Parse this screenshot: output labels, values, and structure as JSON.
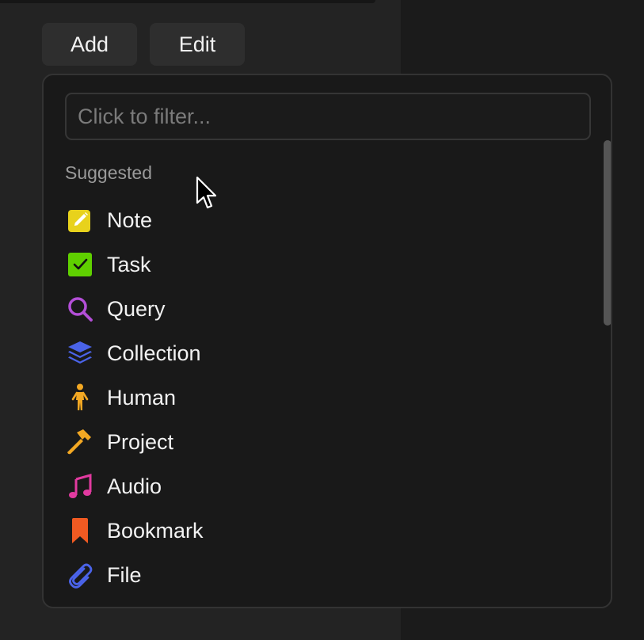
{
  "toolbar": {
    "add_label": "Add",
    "edit_label": "Edit"
  },
  "filter": {
    "placeholder": "Click to filter...",
    "value": ""
  },
  "section": {
    "label": "Suggested"
  },
  "items": [
    {
      "label": "Note",
      "icon": "note-pencil-icon",
      "color": "#e8d21c"
    },
    {
      "label": "Task",
      "icon": "checkbox-icon",
      "color": "#5fd000"
    },
    {
      "label": "Query",
      "icon": "search-icon",
      "color": "#b44fd8"
    },
    {
      "label": "Collection",
      "icon": "layers-icon",
      "color": "#4a63e8"
    },
    {
      "label": "Human",
      "icon": "person-icon",
      "color": "#f3a823"
    },
    {
      "label": "Project",
      "icon": "hammer-icon",
      "color": "#f3a823"
    },
    {
      "label": "Audio",
      "icon": "music-note-icon",
      "color": "#e23aa0"
    },
    {
      "label": "Bookmark",
      "icon": "bookmark-icon",
      "color": "#f05a22"
    },
    {
      "label": "File",
      "icon": "paperclip-icon",
      "color": "#4a63e8"
    }
  ]
}
